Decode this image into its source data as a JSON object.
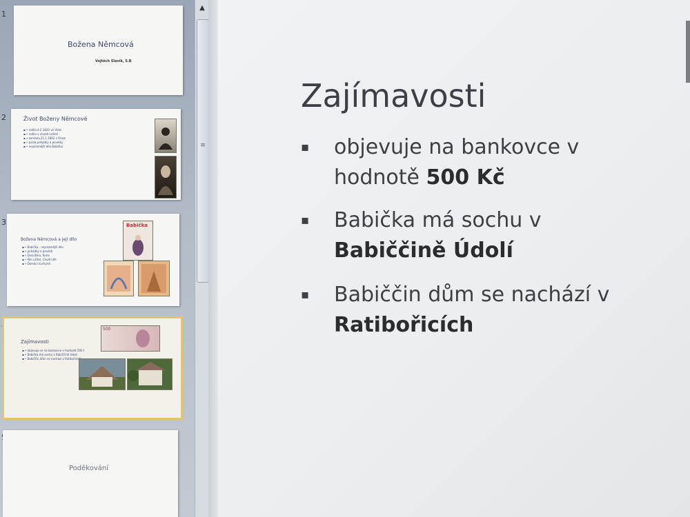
{
  "thumbnails": [
    {
      "number": "1",
      "title": "Božena Němcová",
      "subtitle": "Vojtěch Slavík, 5.B"
    },
    {
      "number": "2",
      "title": "Život Boženy Němcové",
      "bullets": [
        "• rodila 4.2.1820 ve Vídni",
        "• rodila v chudé rodině",
        "• zemřela 21.1.1862 v Praze",
        "• psala pohádky a povídky",
        "• nejznámější dílo Babička"
      ]
    },
    {
      "number": "3",
      "title": "Božena Němcová a její dílo",
      "pic_label": "Babička",
      "bullets": [
        "• Babička - nejznámější dílo",
        "• pohádky a pověsti",
        "• Divá Bára, Karla",
        "• Pan učitel, Chudí lidé",
        "• Domácí kuchyně"
      ]
    },
    {
      "number": "4",
      "title": "Zajímavosti",
      "note_value": "500",
      "bullets": [
        "• objevuje se na bankovce v hodnotě 500 Kč",
        "• Babička má sochu v Babiččině Údolí",
        "• Babiččin dům se nachází v Ratibořicích"
      ]
    },
    {
      "number": "5",
      "title": "Poděkování"
    }
  ],
  "main_slide": {
    "title": "Zajímavosti",
    "bullet_marker": "▪",
    "bullets": [
      {
        "normal": "objevuje na bankovce v hodnotě ",
        "bold": "500 Kč"
      },
      {
        "normal": "Babička má sochu v ",
        "bold": "Babiččině Údolí"
      },
      {
        "normal": "Babiččin dům se nachází v ",
        "bold": "Ratibořicích"
      }
    ]
  },
  "scrollbar": {
    "up_arrow": "▲",
    "grip": "≡"
  },
  "colors": {
    "thumb_title": "#3b4a6b",
    "selected_outline": "#e8c36a",
    "main_text": "#3d3f44"
  }
}
